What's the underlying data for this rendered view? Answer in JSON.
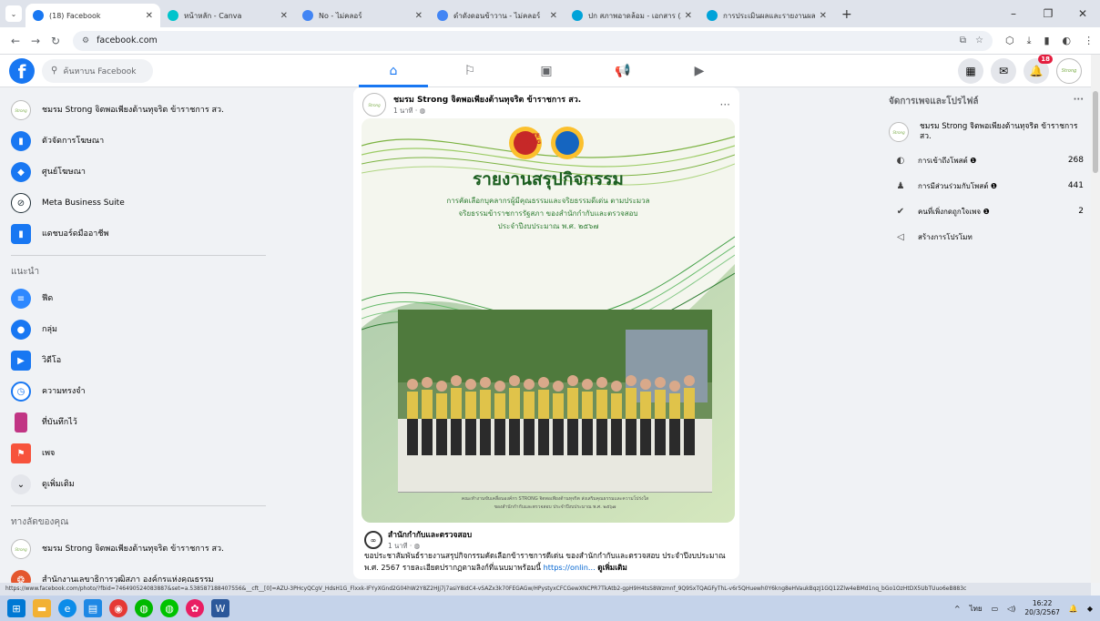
{
  "browser": {
    "tabs": [
      {
        "title": "(18) Facebook",
        "active": true,
        "color": "#1877f2"
      },
      {
        "title": "หน้าหลัก - Canva",
        "active": false,
        "color": "#00c4cc"
      },
      {
        "title": "No - ไม่คลอร์",
        "active": false,
        "color": "#4285f4"
      },
      {
        "title": "ดำดังดอนข้าวาน - ไม่คลอร์",
        "active": false,
        "color": "#4285f4"
      },
      {
        "title": "ปก สภาพอาดล้อม - เอกสาร (A4)",
        "active": false,
        "color": "#00a3d9"
      },
      {
        "title": "การประเมินผลและรายงานผล ตามแบ...",
        "active": false,
        "color": "#00a3d9"
      }
    ],
    "new_tab": "+",
    "address": "facebook.com"
  },
  "facebook": {
    "search_placeholder": "ค้นหาบน Facebook",
    "notification_count": "18",
    "left_nav": {
      "page": {
        "name": "ชมรม Strong จิตพอเพียงต้านทุจริต ข้าราชการ สว."
      },
      "items": [
        {
          "label": "ตัวจัดการโฆษณา",
          "color": "#1877f2",
          "glyph": "▮"
        },
        {
          "label": "ศูนย์โฆษณา",
          "color": "#1877f2",
          "glyph": "◆"
        },
        {
          "label": "Meta Business Suite",
          "color": "#1c2b33",
          "glyph": "⊘"
        },
        {
          "label": "แดชบอร์ดมืออาชีพ",
          "color": "#1877f2",
          "glyph": "▮"
        }
      ],
      "suggest_heading": "แนะนำ",
      "suggest_items": [
        {
          "label": "ฟีด",
          "color": "#2d88ff",
          "glyph": "≡"
        },
        {
          "label": "กลุ่ม",
          "color": "#1877f2",
          "glyph": "●"
        },
        {
          "label": "วิดีโอ",
          "color": "#1877f2",
          "glyph": "▶"
        },
        {
          "label": "ความทรงจำ",
          "color": "#1877f2",
          "glyph": "◷"
        },
        {
          "label": "ที่บันทึกไว้",
          "color": "#c13584",
          "glyph": "▮"
        },
        {
          "label": "เพจ",
          "color": "#f7533c",
          "glyph": "⚑"
        },
        {
          "label": "ดูเพิ่มเติม",
          "color": "#e4e6eb",
          "glyph": "⌄"
        }
      ],
      "shortcuts_heading": "ทางลัดของคุณ",
      "shortcuts": [
        {
          "label": "ชมรม Strong จิตพอเพียงต้านทุจริต ข้าราชการ สว."
        },
        {
          "label": "สำนักงานเลขาธิการวุฒิสภา องค์กรแห่งคุณธรรม"
        }
      ]
    },
    "post": {
      "author": "ชมรม Strong จิตพอเพียงต้านทุจริต ข้าราชการ สว.",
      "time": "1 นาที · ◍",
      "more": "···",
      "image": {
        "logo1": "SENATE STRONG",
        "title": "รายงานสรุปกิจกรรม",
        "sub1": "การคัดเลือกบุคลากรผู้มีคุณธรรมและจริยธรรมดีเด่น ตามประมวล",
        "sub2": "จริยธรรมข้าราชการรัฐสภา ของสำนักกำกับและตรวจสอบ",
        "sub3": "ประจำปีงบประมาณ พ.ศ. ๒๕๖๗",
        "caption1": "คณะทำงานขับเคลื่อนองค์กร STRONG จิตพอเพียงต้านทุจริต ส่งเสริมคุณธรรมและความโปร่งใส",
        "caption2": "ของสำนักกำกับและตรวจสอบ ประจำปีงบประมาณ พ.ศ. ๒๕๖๗"
      },
      "shared_name": "สำนักกำกับและตรวจสอบ",
      "shared_time": "1 นาที · ◍",
      "text": "ขอประชาสัมพันธ์รายงานสรุปกิจกรรมคัดเลือกข้าราชการดีเด่น ของสำนักกำกับและตรวจสอบ ประจำปีงบประมาณ พ.ศ. 2567 รายละเอียดปรากฏตามลิงก์ที่แนบมาพร้อมนี้ ",
      "link": "https://onlin...",
      "see_more": "ดูเพิ่มเติม"
    },
    "right_panel": {
      "title": "จัดการเพจและโปรไฟล์",
      "more": "···",
      "page": "ชมรม Strong จิตพอเพียงต้านทุจริต ข้าราชการ สว.",
      "rows": [
        {
          "label": "การเข้าถึงโพสต์ ❶",
          "value": "268",
          "glyph": "◐"
        },
        {
          "label": "การมีส่วนร่วมกับโพสต์ ❶",
          "value": "441",
          "glyph": "👥"
        },
        {
          "label": "คนที่เพิ่งกดถูกใจเพจ ❶",
          "value": "2",
          "glyph": "👍"
        },
        {
          "label": "สร้างการโปรโมท",
          "value": "",
          "glyph": "📣"
        }
      ]
    }
  },
  "status_url": "https://www.facebook.com/photo/?fbid=746490524083887&set=a.538587188407556&__cft__[0]=AZU-3PHcyQCgV_HdsH1G_Flxxk-IFYyXGnd2G04hW2Y8Z2HJj7j7asiY8idC4-vSAZx3k70FEGAGw/HPystyxCFCGewXNCPR7TkAtb2-gpH9H4tsS8Wzmnf_9Q9SxTQAGFyThL-v6r5QHuewh0Y6kng8eHVaukBqzJ1GQ12Zlw4eBMd1nq_bGo1OzHtDX5UbTUuo6eB883c",
  "taskbar": {
    "time": "16:22",
    "date": "20/3/2567",
    "lang": "ไทย"
  }
}
